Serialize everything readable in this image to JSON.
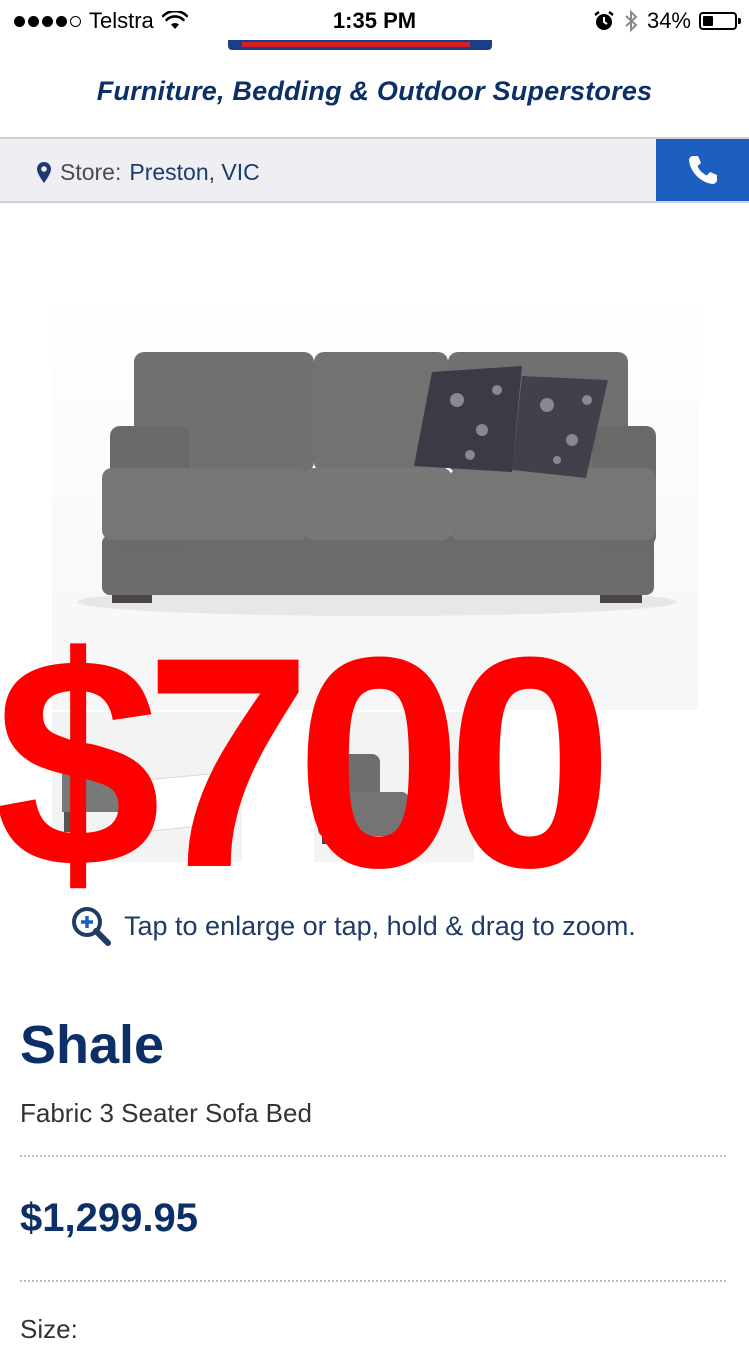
{
  "status_bar": {
    "carrier": "Telstra",
    "time": "1:35 PM",
    "battery_percent": "34%",
    "battery_level": 0.34
  },
  "header": {
    "tagline": "Furniture, Bedding & Outdoor Superstores",
    "store_prefix": "Store:",
    "store_name": "Preston, VIC"
  },
  "colors": {
    "brand_navy": "#0b2f66",
    "phone_button_blue": "#1d5fbf",
    "overlay_red": "#ff0000"
  },
  "overlay": {
    "price_text": "$700"
  },
  "gallery": {
    "zoom_hint": "Tap to enlarge or tap, hold & drag to zoom."
  },
  "product": {
    "name": "Shale",
    "description": "Fabric 3 Seater Sofa Bed",
    "price": "$1,299.95",
    "size_label": "Size:"
  },
  "icons": [
    "wifi-icon",
    "alarm-icon",
    "bluetooth-icon",
    "battery-icon",
    "map-marker-icon",
    "phone-icon",
    "zoom-in-icon"
  ]
}
